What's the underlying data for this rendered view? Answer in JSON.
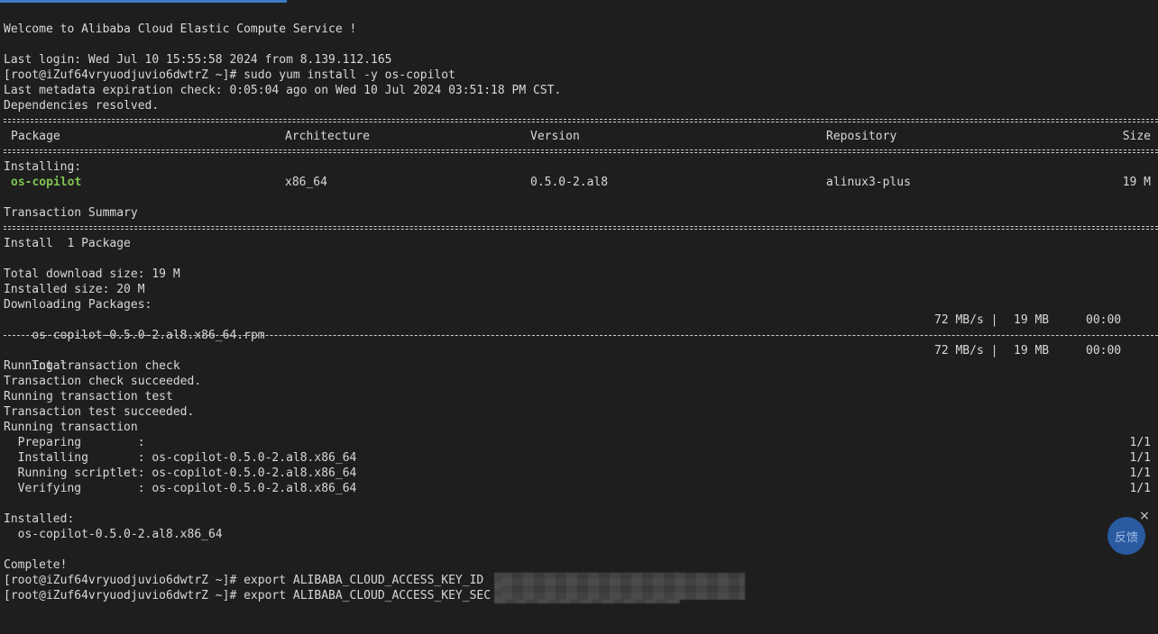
{
  "welcome": "Welcome to Alibaba Cloud Elastic Compute Service !",
  "last_login": "Last login: Wed Jul 10 15:55:58 2024 from 8.139.112.165",
  "prompt": "[root@iZuf64vryuodjuvio6dwtrZ ~]# ",
  "cmd_install": "sudo yum install -y os-copilot",
  "metadata_check": "Last metadata expiration check: 0:05:04 ago on Wed 10 Jul 2024 03:51:18 PM CST.",
  "deps_resolved": "Dependencies resolved.",
  "table": {
    "headers": {
      "package": "Package",
      "arch": "Architecture",
      "version": "Version",
      "repo": "Repository",
      "size": "Size"
    },
    "installing_label": "Installing:",
    "row": {
      "package": "os-copilot",
      "arch": "x86_64",
      "version": "0.5.0-2.al8",
      "repo": "alinux3-plus",
      "size": "19 M"
    }
  },
  "transaction_summary": "Transaction Summary",
  "install_count": "Install  1 Package",
  "total_download": "Total download size: 19 M",
  "installed_size": "Installed size: 20 M",
  "downloading": "Downloading Packages:",
  "rpm": {
    "name": "os-copilot-0.5.0-2.al8.x86_64.rpm",
    "speed": "72 MB/s |",
    "size": "19 MB",
    "time": "00:00"
  },
  "total": {
    "label": "Total",
    "speed": "72 MB/s |",
    "size": "19 MB",
    "time": "00:00"
  },
  "run_check": "Running transaction check",
  "check_ok": "Transaction check succeeded.",
  "run_test": "Running transaction test",
  "test_ok": "Transaction test succeeded.",
  "run_tx": "Running transaction",
  "steps": [
    {
      "label": "  Preparing        :",
      "pkg": "",
      "progress": "1/1"
    },
    {
      "label": "  Installing       :",
      "pkg": " os-copilot-0.5.0-2.al8.x86_64",
      "progress": "1/1"
    },
    {
      "label": "  Running scriptlet:",
      "pkg": " os-copilot-0.5.0-2.al8.x86_64",
      "progress": "1/1"
    },
    {
      "label": "  Verifying        :",
      "pkg": " os-copilot-0.5.0-2.al8.x86_64",
      "progress": "1/1"
    }
  ],
  "installed_label": "Installed:",
  "installed_pkg": "  os-copilot-0.5.0-2.al8.x86_64",
  "complete": "Complete!",
  "cmd_export_id": "export ALIBABA_CLOUD_ACCESS_KEY_ID",
  "cmd_export_secret": "export ALIBABA_CLOUD_ACCESS_KEY_SEC",
  "feedback": {
    "label": "反馈",
    "close": "×"
  },
  "colors": {
    "background": "#1e1e1e",
    "text": "#d8d8d8",
    "package_highlight": "#7ec352",
    "feedback_bg": "#2a5aa0"
  }
}
